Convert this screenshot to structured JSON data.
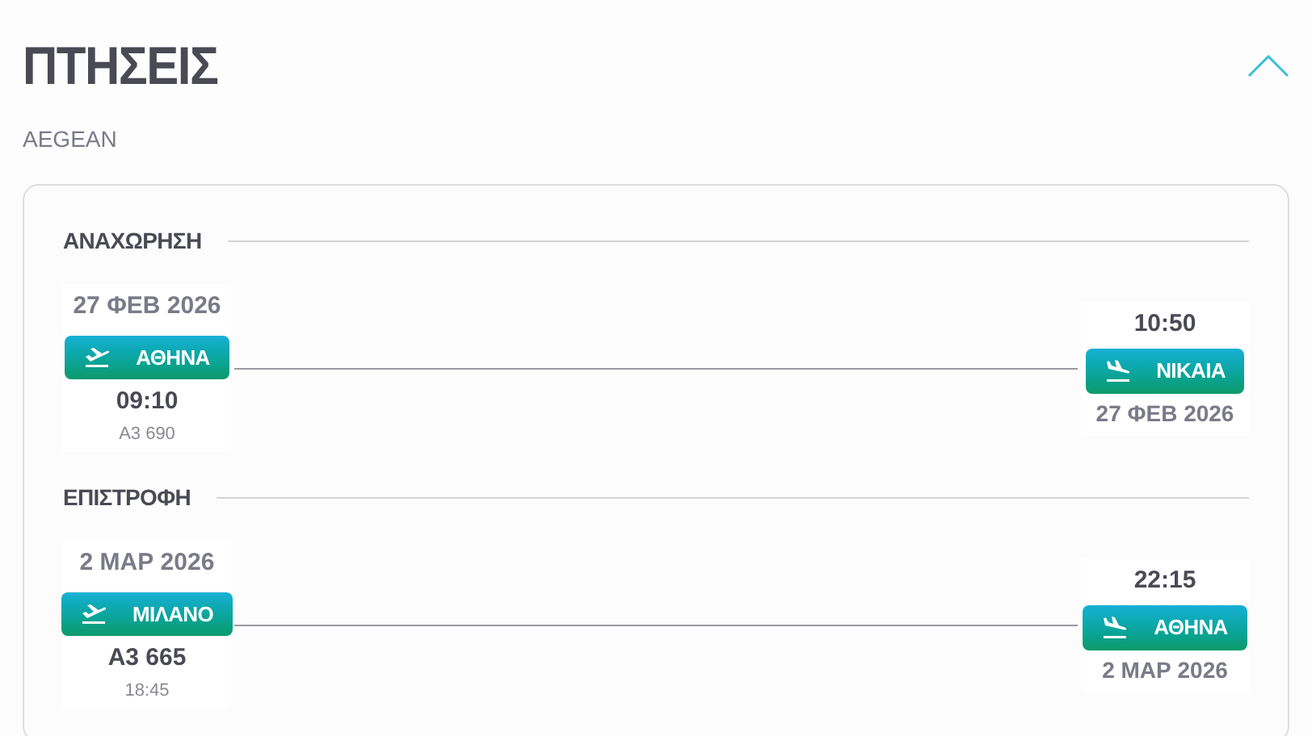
{
  "title": "ΠΤΗΣΕΙΣ",
  "expanded": true,
  "airline": "AEGEAN",
  "legs": [
    {
      "heading": "ΑΝΑΧΩΡΗΣΗ",
      "origin": {
        "kind": "departure",
        "date": "27 ΦΕΒ 2026",
        "city": "ΑΘΗΝΑ",
        "primary": "09:10",
        "secondary": "A3 690"
      },
      "destination": {
        "kind": "arrival",
        "time": "10:50",
        "city": "ΝΙΚΑΙΑ",
        "date": "27 ΦΕΒ 2026"
      }
    },
    {
      "heading": "ΕΠΙΣΤΡΟΦΗ",
      "origin": {
        "kind": "departure",
        "date": "2 ΜΑΡ 2026",
        "city": "ΜΙΛΑΝΟ",
        "primary": "A3 665",
        "secondary": "18:45"
      },
      "destination": {
        "kind": "arrival",
        "time": "22:15",
        "city": "ΑΘΗΝΑ",
        "date": "2 ΜΑΡ 2026"
      }
    }
  ]
}
